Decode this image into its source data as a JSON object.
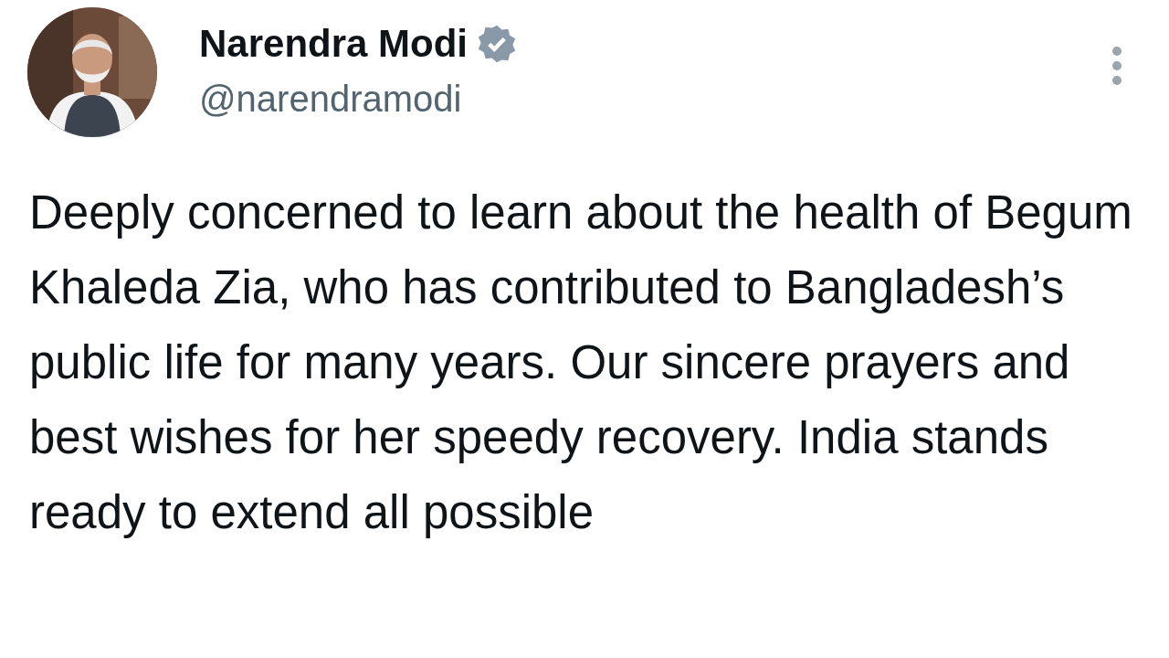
{
  "author": {
    "name": "Narendra Modi",
    "verified": true,
    "handle": "@narendramodi"
  },
  "post": {
    "text": "Deeply concerned to learn about the health of Begum Khaleda Zia, who has contributed to Bangladesh’s public life for many years. Our sincere prayers and best wishes for her speedy recovery. India stands ready to extend all possible"
  }
}
